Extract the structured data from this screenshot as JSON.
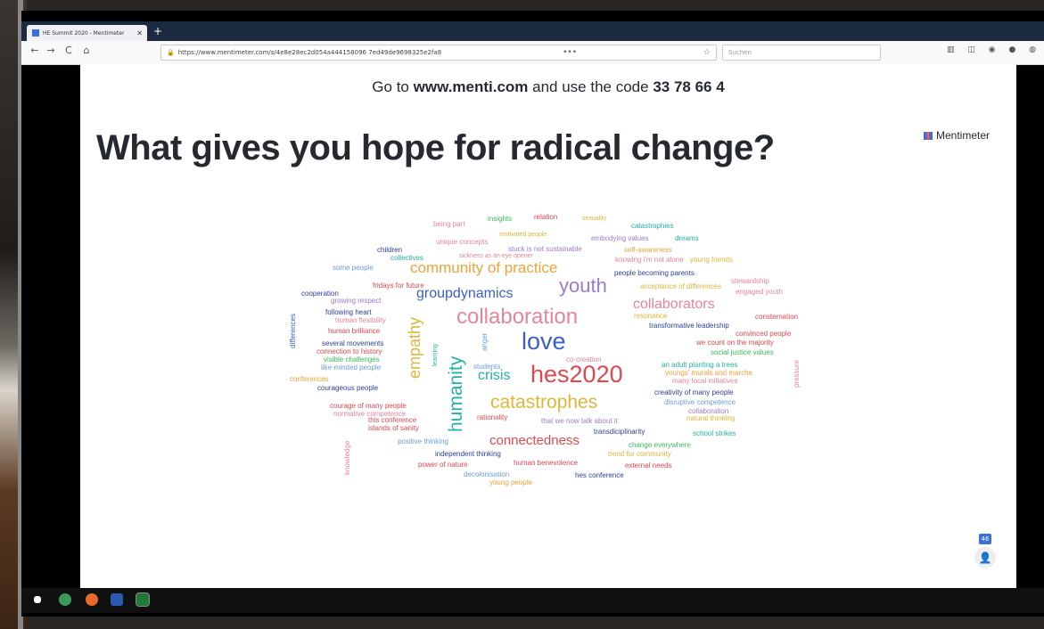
{
  "browser": {
    "tab_title": "HE Summit 2020 - Mentimeter",
    "tab_close": "✕",
    "new_tab": "+",
    "url": "https://www.mentimeter.com/s/4e8e28ec2d054a444158096 7ed49de9698325e2fa8",
    "search_placeholder": "Suchen",
    "nav": {
      "back": "←",
      "forward": "→",
      "reload": "C",
      "home": "⌂"
    },
    "overflow": "•••",
    "star": "☆"
  },
  "slide": {
    "prompt_prefix": "Go to",
    "url": "www.menti.com",
    "prompt_middle": "and use the code",
    "code": "33 78 66 4",
    "question": "What gives you hope for radical change?",
    "brand": "Mentimeter",
    "participant_count": "46"
  },
  "colors": {
    "blue": "#3a5fcd",
    "pink": "#e8849a",
    "red": "#e0484f",
    "teal": "#22b3a0",
    "orange": "#f0a23a",
    "yellow": "#e0b63a",
    "green": "#3cb85c",
    "navy": "#2b3f9e",
    "purple": "#9a7bd8",
    "lightblue": "#6b9be0"
  },
  "words": [
    {
      "text": "being part",
      "color": "pink"
    },
    {
      "text": "insights",
      "color": "green"
    },
    {
      "text": "relation",
      "color": "red"
    },
    {
      "text": "sexuality",
      "color": "yellow"
    },
    {
      "text": "catastrophies",
      "color": "teal"
    },
    {
      "text": "unique concepts",
      "color": "pink"
    },
    {
      "text": "motivated people",
      "color": "yellow"
    },
    {
      "text": "embodying values",
      "color": "purple"
    },
    {
      "text": "dreams",
      "color": "teal"
    },
    {
      "text": "children",
      "color": "navy"
    },
    {
      "text": "stuck is not sustainable",
      "color": "purple"
    },
    {
      "text": "self-awareness",
      "color": "orange"
    },
    {
      "text": "collectives",
      "color": "teal"
    },
    {
      "text": "sickness as an eye opener",
      "color": "pink"
    },
    {
      "text": "knowing i'm not alone",
      "color": "pink"
    },
    {
      "text": "young friends",
      "color": "yellow"
    },
    {
      "text": "some people",
      "color": "lightblue"
    },
    {
      "text": "community of practice",
      "color": "orange"
    },
    {
      "text": "people becoming parents",
      "color": "navy"
    },
    {
      "text": "fridays for future",
      "color": "red"
    },
    {
      "text": "youth",
      "color": "purple"
    },
    {
      "text": "acceptance of differences",
      "color": "yellow"
    },
    {
      "text": "stewardship",
      "color": "pink"
    },
    {
      "text": "cooperation",
      "color": "navy"
    },
    {
      "text": "groupdynamics",
      "color": "blue"
    },
    {
      "text": "engaged youth",
      "color": "pink"
    },
    {
      "text": "growing respect",
      "color": "purple"
    },
    {
      "text": "collaborators",
      "color": "pink"
    },
    {
      "text": "following heart",
      "color": "navy"
    },
    {
      "text": "resonance",
      "color": "yellow"
    },
    {
      "text": "human flexibility",
      "color": "pink"
    },
    {
      "text": "collaboration",
      "color": "pink"
    },
    {
      "text": "consternation",
      "color": "red"
    },
    {
      "text": "transformative leadership",
      "color": "navy"
    },
    {
      "text": "human brilliance",
      "color": "red"
    },
    {
      "text": "convinced people",
      "color": "red"
    },
    {
      "text": "several movements",
      "color": "navy"
    },
    {
      "text": "we count on the majority",
      "color": "red"
    },
    {
      "text": "connection to history",
      "color": "red"
    },
    {
      "text": "love",
      "color": "blue"
    },
    {
      "text": "social justice values",
      "color": "green"
    },
    {
      "text": "visible challenges",
      "color": "green"
    },
    {
      "text": "co-creation",
      "color": "pink"
    },
    {
      "text": "an adult planting a trees",
      "color": "teal"
    },
    {
      "text": "like-minded people",
      "color": "lightblue"
    },
    {
      "text": "students",
      "color": "lightblue"
    },
    {
      "text": "youngs' murals and marche",
      "color": "orange"
    },
    {
      "text": "hes2020",
      "color": "red"
    },
    {
      "text": "conferences",
      "color": "orange"
    },
    {
      "text": "crisis",
      "color": "teal"
    },
    {
      "text": "many local initiatives",
      "color": "pink"
    },
    {
      "text": "courageous people",
      "color": "navy"
    },
    {
      "text": "creativity of many people",
      "color": "navy"
    },
    {
      "text": "catastrophes",
      "color": "yellow"
    },
    {
      "text": "disruptive competence",
      "color": "lightblue"
    },
    {
      "text": "courage of many people",
      "color": "red"
    },
    {
      "text": "collaboration",
      "color": "purple"
    },
    {
      "text": "normative competence",
      "color": "pink"
    },
    {
      "text": "natural thinking",
      "color": "yellow"
    },
    {
      "text": "this conference",
      "color": "red"
    },
    {
      "text": "rationality",
      "color": "red"
    },
    {
      "text": "that we now talk about it",
      "color": "purple"
    },
    {
      "text": "islands of sanity",
      "color": "red"
    },
    {
      "text": "transdiciplinarity",
      "color": "navy"
    },
    {
      "text": "school strikes",
      "color": "teal"
    },
    {
      "text": "positive thinking",
      "color": "lightblue"
    },
    {
      "text": "connectedness",
      "color": "red"
    },
    {
      "text": "change everywhere",
      "color": "green"
    },
    {
      "text": "independent thinking",
      "color": "navy"
    },
    {
      "text": "trend for community",
      "color": "yellow"
    },
    {
      "text": "power of nature",
      "color": "red"
    },
    {
      "text": "human benevolence",
      "color": "red"
    },
    {
      "text": "external needs",
      "color": "red"
    },
    {
      "text": "decolonisation",
      "color": "lightblue"
    },
    {
      "text": "hes conference",
      "color": "navy"
    },
    {
      "text": "young people",
      "color": "orange"
    },
    {
      "text": "differences",
      "color": "blue"
    },
    {
      "text": "empathy",
      "color": "yellow"
    },
    {
      "text": "learning",
      "color": "teal"
    },
    {
      "text": "humanity",
      "color": "teal"
    },
    {
      "text": "anger",
      "color": "lightblue"
    },
    {
      "text": "knowledge",
      "color": "pink"
    },
    {
      "text": "pressure",
      "color": "pink"
    }
  ]
}
